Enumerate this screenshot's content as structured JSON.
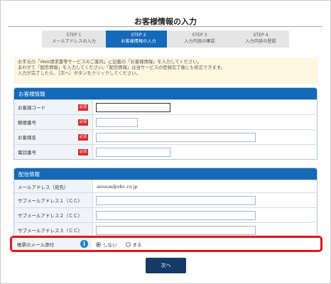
{
  "page": {
    "title": "お客様情報の入力"
  },
  "steps": [
    {
      "num": "STEP 1",
      "label": "メールアドレスの入力",
      "active": false
    },
    {
      "num": "STEP 2",
      "label": "お客様情報の入力",
      "active": true
    },
    {
      "num": "STEP 3",
      "label": "入力内容の確認",
      "active": false
    },
    {
      "num": "STEP 4",
      "label": "入力内容の登録",
      "active": false
    }
  ],
  "info": {
    "lines": [
      "お手元の「Web請求書等サービスのご案内」に記載の「お客様情報」を入力してください。",
      "あわせて「配信情報」を入力してください。「配信情報」は当サービスの登録完了後にも修正できます。",
      "入力が完了したら、［次へ］ボタンをクリックしてください。"
    ]
  },
  "customer_section": {
    "title": "お客様情報",
    "required_label": "必須",
    "rows": [
      {
        "label": "お客様コード",
        "value": ""
      },
      {
        "label": "郵便番号",
        "value": ""
      },
      {
        "label": "お客様名",
        "value": ""
      },
      {
        "label": "電話番号",
        "value": ""
      }
    ]
  },
  "delivery_section": {
    "title": "配信情報",
    "email_label": "メールアドレス（宛先）",
    "email_value": "ainoue@obc.co.jp",
    "sub_rows": [
      {
        "label": "サブメールアドレス１（ＣＣ）",
        "value": ""
      },
      {
        "label": "サブメールアドレス２（ＣＣ）",
        "value": ""
      },
      {
        "label": "サブメールアドレス３（ＣＣ）",
        "value": ""
      }
    ],
    "attachment": {
      "label": "帳票のメール添付",
      "options": [
        {
          "label": "しない",
          "selected": true
        },
        {
          "label": "する",
          "selected": false
        }
      ]
    }
  },
  "actions": {
    "next_label": "次へ"
  },
  "colors": {
    "accent": "#1469b8",
    "required": "#d32f2f",
    "highlight": "#e0161b",
    "button": "#153a66"
  }
}
